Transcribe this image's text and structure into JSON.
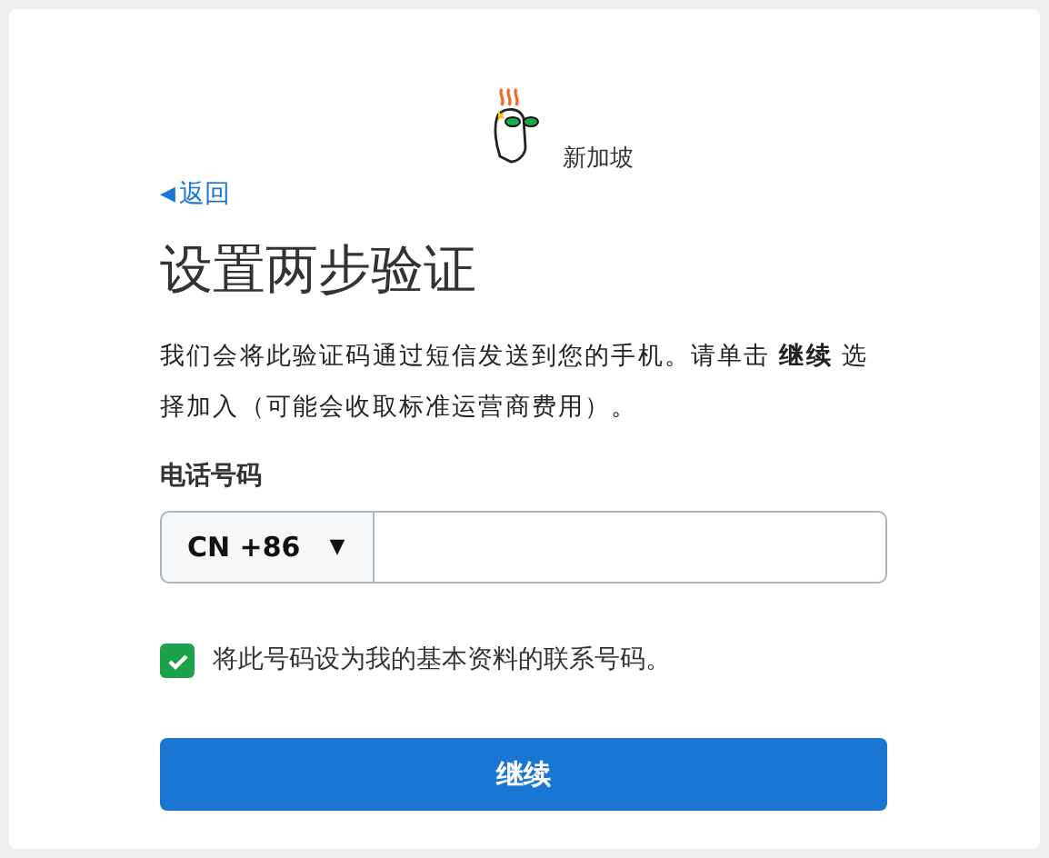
{
  "logo": {
    "region": "新加坡"
  },
  "back_link": {
    "arrow": "◀",
    "label": "返回"
  },
  "title": "设置两步验证",
  "description": "我们会将此验证码通过短信发送到您的手机。请单击 **继续** 选择加入（可能会收取标准运营商费用）。",
  "phone": {
    "label": "电话号码",
    "country_code": "CN +86",
    "caret": "▼"
  },
  "contact_checkbox": {
    "label": "将此号码设为我的基本资料的联系号码。",
    "checked": true
  },
  "continue_button": "继续"
}
